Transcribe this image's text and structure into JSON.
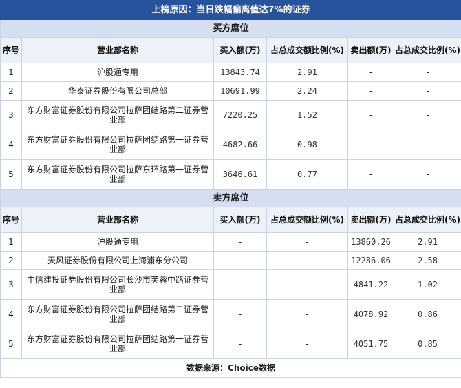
{
  "title": "上榜原因：当日跌幅偏离值达7%的证券",
  "buy_section": {
    "label": "买方席位",
    "headers": [
      "序号",
      "营业部名称",
      "买入额(万)",
      "占总成交额比例(%)",
      "卖出额(万)",
      "占总成交比例(%)"
    ],
    "rows": [
      {
        "no": "1",
        "name": "沪股通专用",
        "buy": "13843.74",
        "buy_pct": "2.91",
        "sell": "-",
        "sell_pct": "-"
      },
      {
        "no": "2",
        "name": "华泰证券股份有限公司总部",
        "buy": "10691.99",
        "buy_pct": "2.24",
        "sell": "-",
        "sell_pct": "-"
      },
      {
        "no": "3",
        "name": "东方财富证券股份有限公司拉萨团结路第二证券营业部",
        "buy": "7220.25",
        "buy_pct": "1.52",
        "sell": "-",
        "sell_pct": "-"
      },
      {
        "no": "4",
        "name": "东方财富证券股份有限公司拉萨团结路第一证券营业部",
        "buy": "4682.66",
        "buy_pct": "0.98",
        "sell": "-",
        "sell_pct": "-"
      },
      {
        "no": "5",
        "name": "东方财富证券股份有限公司拉萨东环路第一证券营业部",
        "buy": "3646.61",
        "buy_pct": "0.77",
        "sell": "-",
        "sell_pct": "-"
      }
    ]
  },
  "sell_section": {
    "label": "卖方席位",
    "headers": [
      "序号",
      "营业部名称",
      "买入额(万)",
      "占总成交额比例(%)",
      "卖出额(万)",
      "占总成交比例(%)"
    ],
    "rows": [
      {
        "no": "1",
        "name": "沪股通专用",
        "buy": "-",
        "buy_pct": "-",
        "sell": "13860.26",
        "sell_pct": "2.91"
      },
      {
        "no": "2",
        "name": "天风证券股份有限公司上海浦东分公司",
        "buy": "-",
        "buy_pct": "-",
        "sell": "12286.06",
        "sell_pct": "2.58"
      },
      {
        "no": "3",
        "name": "中信建投证券股份有限公司长沙市芙蓉中路证券营业部",
        "buy": "-",
        "buy_pct": "-",
        "sell": "4841.22",
        "sell_pct": "1.02"
      },
      {
        "no": "4",
        "name": "东方财富证券股份有限公司拉萨团结路第二证券营业部",
        "buy": "-",
        "buy_pct": "-",
        "sell": "4078.92",
        "sell_pct": "0.86"
      },
      {
        "no": "5",
        "name": "东方财富证券股份有限公司拉萨团结路第一证券营业部",
        "buy": "-",
        "buy_pct": "-",
        "sell": "4051.75",
        "sell_pct": "0.85"
      }
    ]
  },
  "footer": "数据来源：Choice数据",
  "colors": {
    "title_bg": "#26539b",
    "section_bg": "#d5dff1",
    "header_bg": "#edf1f8",
    "border": "#c9d3e3"
  }
}
